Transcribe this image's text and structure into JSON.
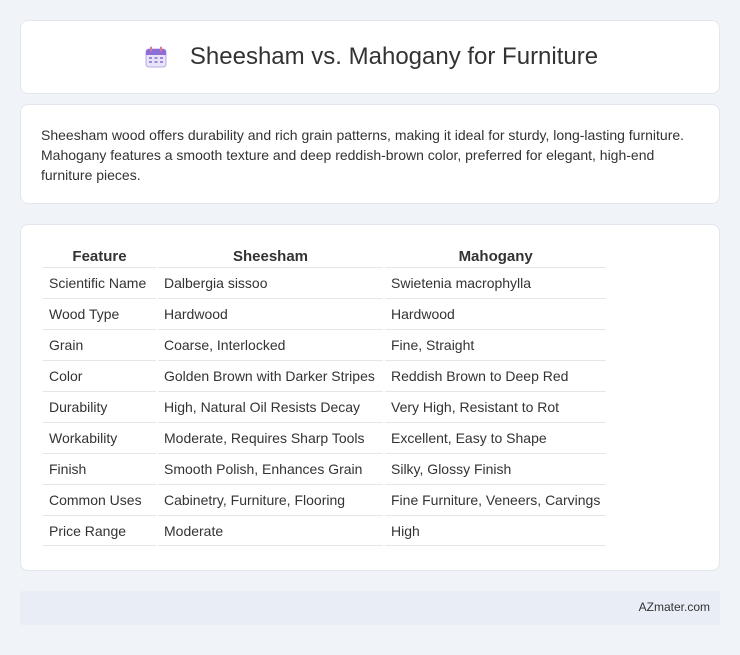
{
  "header": {
    "icon": "calendar-icon",
    "title": "Sheesham vs. Mahogany for Furniture"
  },
  "intro": {
    "text": "Sheesham wood offers durability and rich grain patterns, making it ideal for sturdy, long-lasting furniture. Mahogany features a smooth texture and deep reddish-brown color, preferred for elegant, high-end furniture pieces."
  },
  "table": {
    "headers": [
      "Feature",
      "Sheesham",
      "Mahogany"
    ],
    "rows": [
      [
        "Scientific Name",
        "Dalbergia sissoo",
        "Swietenia macrophylla"
      ],
      [
        "Wood Type",
        "Hardwood",
        "Hardwood"
      ],
      [
        "Grain",
        "Coarse, Interlocked",
        "Fine, Straight"
      ],
      [
        "Color",
        "Golden Brown with Darker Stripes",
        "Reddish Brown to Deep Red"
      ],
      [
        "Durability",
        "High, Natural Oil Resists Decay",
        "Very High, Resistant to Rot"
      ],
      [
        "Workability",
        "Moderate, Requires Sharp Tools",
        "Excellent, Easy to Shape"
      ],
      [
        "Finish",
        "Smooth Polish, Enhances Grain",
        "Silky, Glossy Finish"
      ],
      [
        "Common Uses",
        "Cabinetry, Furniture, Flooring",
        "Fine Furniture, Veneers, Carvings"
      ],
      [
        "Price Range",
        "Moderate",
        "High"
      ]
    ]
  },
  "footer": {
    "text": "AZmater.com"
  }
}
